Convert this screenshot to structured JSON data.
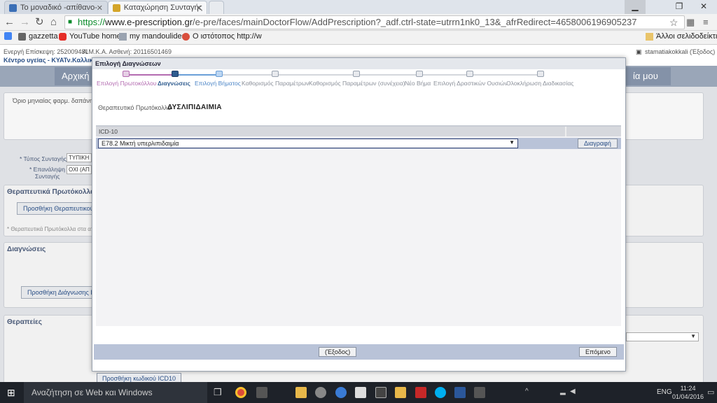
{
  "browser": {
    "tabs": [
      {
        "title": "Το μοναδικό -απίθανο- ο",
        "active": false
      },
      {
        "title": "Καταχώρηση Συνταγής",
        "active": true
      }
    ],
    "url": {
      "scheme": "https://",
      "host": "www.e-prescription.gr",
      "path": "/e-pre/faces/mainDoctorFlow/AddPrescription?_adf.ctrl-state=utrrn1nk0_13&_afrRedirect=4658006196905237"
    },
    "bookmarks": [
      "gazzetta",
      "YouTube home",
      "my mandoulides",
      "Ο ιστότοπος http://w"
    ],
    "other_bookmarks": "Άλλοι σελιδοδείκτες"
  },
  "page": {
    "active_visit": "Ενεργή Επίσκεψη: 252009481",
    "amka": "Α.Μ.Κ.Α. Ασθενή: 20116501469",
    "center": "Κέντρο υγείας - ΚΥΑΤν.Καλλικ",
    "user": "stamatiakokkali (Έξοδος)",
    "home_btn": "Αρχική",
    "my_btn": "ία μου",
    "monthly_limit": "Όριο μηνιαίας φαρμ. δαπάνης Ε",
    "rx_type_label": "* Τύπος Συνταγής",
    "rx_type_value": "ΤΥΠΙΚΗ",
    "repeat_label_1": "* Επανάληψη",
    "repeat_label_2": "Συνταγής",
    "repeat_value": "ΟΧΙ (ΑΠ",
    "protocols_title": "Θεραπευτικά Πρωτόκολλα",
    "add_protocol_btn": "Προσθήκη Θεραπευτικού Πρ",
    "protocols_note": "* Θεραπευτικά Πρωτόκολλα στα απ",
    "diagnoses_title": "Διαγνώσεις",
    "add_diagnosis_btn": "Προσθήκη Διάγνωσης ICD-1",
    "therapies_title": "Θεραπείες"
  },
  "modal": {
    "title": "Επιλογή Διαγνώσεων",
    "steps": [
      {
        "label": "Επιλογή Πρωτοκόλλου",
        "state": "done"
      },
      {
        "label": "Διαγνώσεις",
        "state": "current"
      },
      {
        "label": "Επιλογή Βήματος",
        "state": "next"
      },
      {
        "label": "Καθορισμός Παραμέτρων",
        "state": "todo"
      },
      {
        "label": "Καθορισμός Παραμέτρων (συνέχεια)",
        "state": "todo"
      },
      {
        "label": "Νέο Βήμα",
        "state": "todo"
      },
      {
        "label": "Επιλογή Δραστικών Ουσιών",
        "state": "todo"
      },
      {
        "label": "Ολοκλήρωση Διαδικασίας",
        "state": "todo"
      }
    ],
    "protocol_label": "Θεραπευτικό Πρωτόκολλο",
    "protocol_value": "ΔΥΣΛΙΠΙΔΑΙΜΙΑ",
    "table_header": "ICD-10",
    "icd_selected": "E78.2 Μικτή υπερλιπιδαιμία",
    "delete_btn": "Διαγραφή",
    "add_icd_btn": "Προσθήκη κωδικού ICD10",
    "exit_btn": "(Έξοδος)",
    "next_btn": "Επόμενο"
  },
  "taskbar": {
    "search_placeholder": "Αναζήτηση σε Web και Windows",
    "lang": "ENG",
    "time": "11:24",
    "date": "01/04/2016"
  },
  "colors": {
    "step_done": "#b36bb0",
    "step_current": "#2f5c8f",
    "step_next": "#6a9fd8",
    "footer_bar": "#b9c3d8"
  }
}
